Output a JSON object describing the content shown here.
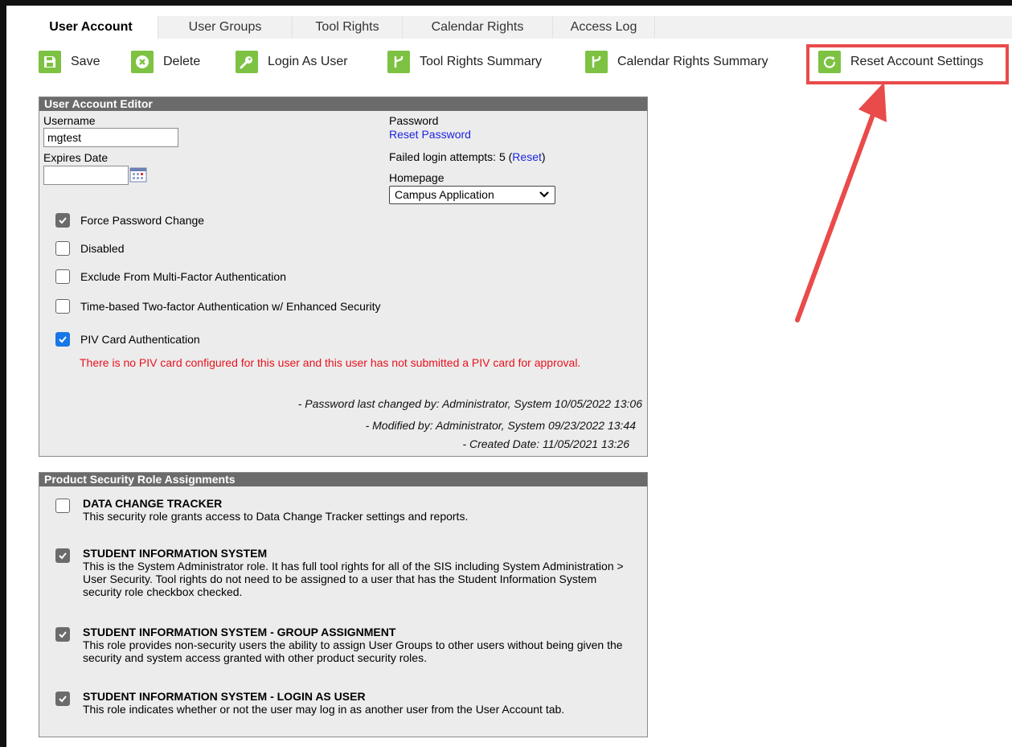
{
  "tabs": [
    {
      "label": "User Account"
    },
    {
      "label": "User Groups"
    },
    {
      "label": "Tool Rights"
    },
    {
      "label": "Calendar Rights"
    },
    {
      "label": "Access Log"
    }
  ],
  "toolbar": {
    "save": "Save",
    "delete": "Delete",
    "login_as_user": "Login As User",
    "tool_rights_summary": "Tool Rights Summary",
    "calendar_rights_summary": "Calendar Rights Summary",
    "reset_account_settings": "Reset Account Settings"
  },
  "editor": {
    "title": "User Account Editor",
    "username_label": "Username",
    "username_value": "mgtest",
    "expires_label": "Expires Date",
    "expires_value": "",
    "password_label": "Password",
    "reset_password": "Reset Password",
    "failed_login_text": "Failed login attempts: 5 (",
    "failed_login_reset": "Reset",
    "failed_login_close": ")",
    "homepage_label": "Homepage",
    "homepage_value": "Campus Application",
    "checkboxes": [
      {
        "label": "Force Password Change",
        "checked": true
      },
      {
        "label": "Disabled",
        "checked": false
      },
      {
        "label": "Exclude From Multi-Factor Authentication",
        "checked": false
      },
      {
        "label": "Time-based Two-factor Authentication w/ Enhanced Security",
        "checked": false
      },
      {
        "label": "PIV Card Authentication",
        "checked": true
      }
    ],
    "piv_warning": "There is no PIV card configured for this user and this user has not submitted a PIV card for approval.",
    "password_changed": "- Password last changed by: Administrator, System 10/05/2022 13:06",
    "modified_by": "- Modified by: Administrator, System 09/23/2022 13:44",
    "created_date": "- Created Date: 11/05/2021 13:26"
  },
  "roles": {
    "title": "Product Security Role Assignments",
    "items": [
      {
        "title": "DATA CHANGE TRACKER",
        "desc": "This security role grants access to Data Change Tracker settings and reports.",
        "checked": false
      },
      {
        "title": "STUDENT INFORMATION SYSTEM",
        "desc": "This is the System Administrator role. It has full tool rights for all of the SIS including System Administration > User Security. Tool rights do not need to be assigned to a user that has the Student Information System security role checkbox checked.",
        "checked": true
      },
      {
        "title": "STUDENT INFORMATION SYSTEM - GROUP ASSIGNMENT",
        "desc": "This role provides non-security users the ability to assign User Groups to other users without being given the security and system access granted with other product security roles.",
        "checked": true
      },
      {
        "title": "STUDENT INFORMATION SYSTEM - LOGIN AS USER",
        "desc": "This role indicates whether or not the user may log in as another user from the User Account tab.",
        "checked": true
      }
    ]
  },
  "colors": {
    "accent_green": "#7dc242",
    "highlight_red": "#e94b4b",
    "warning_red": "#e8121d",
    "link_blue": "#1c24e0"
  }
}
